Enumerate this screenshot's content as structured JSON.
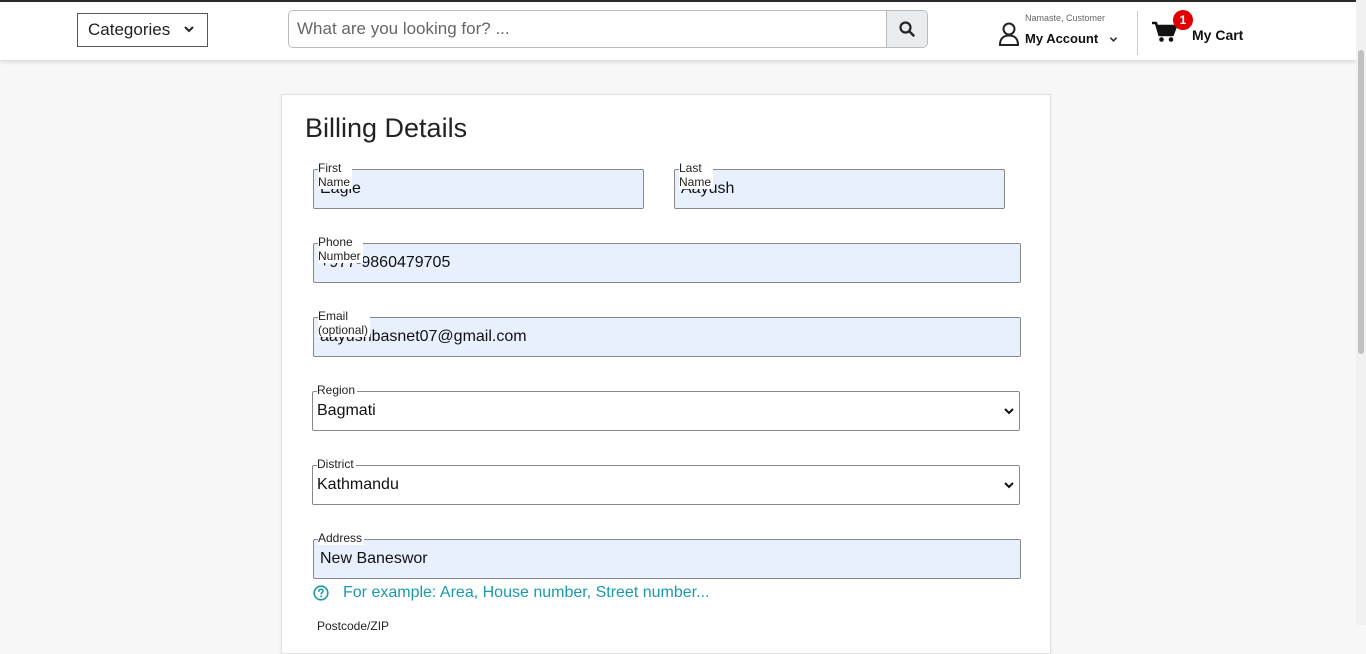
{
  "header": {
    "categories_label": "Categories",
    "search_placeholder": "What are you looking for? ...",
    "greeting": "Namaste, Customer",
    "account_label": "My Account",
    "cart_count": "1",
    "cart_label": "My Cart"
  },
  "billing": {
    "title": "Billing Details",
    "first_name_label": "First Name",
    "first_name_value": "Eagle",
    "last_name_label": "Last Name",
    "last_name_value": "Aayush",
    "phone_label": "Phone Number",
    "phone_value": "+977-9860479705",
    "email_label": "Email (optional)",
    "email_value": "aayushbasnet07@gmail.com",
    "region_label": "Region",
    "region_value": "Bagmati",
    "district_label": "District",
    "district_value": "Kathmandu",
    "address_label": "Address",
    "address_value": "New Baneswor",
    "address_hint": "For example: Area, House number, Street number...",
    "postcode_label": "Postcode/ZIP"
  },
  "colors": {
    "hint": "#1a9aaa",
    "badge": "#e00000",
    "autofill": "#e8f0fe"
  }
}
